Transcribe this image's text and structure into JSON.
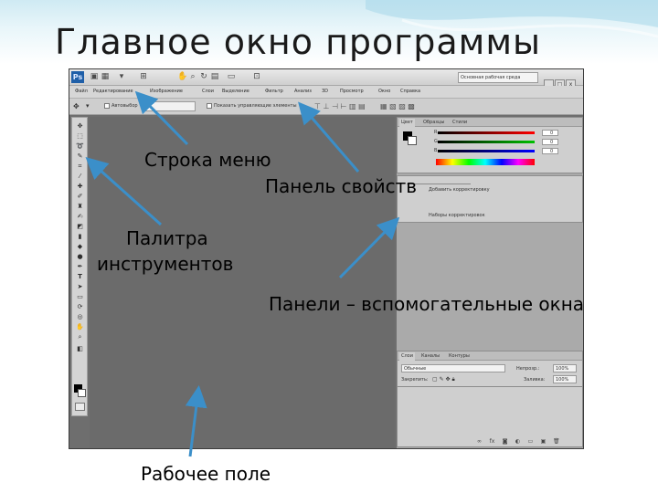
{
  "slide": {
    "title": "Главное окно программы"
  },
  "app": {
    "logo_text": "Ps",
    "workspace_select": "Основная рабочая среда",
    "window_buttons": [
      "_",
      "□",
      "x"
    ]
  },
  "menubar": {
    "items": [
      "Файл",
      "Редактирование",
      "Изображение",
      "Слои",
      "Выделение",
      "Фильтр",
      "Анализ",
      "3D",
      "Просмотр",
      "Окно",
      "Справка"
    ]
  },
  "options_bar": {
    "checkbox_label": "Автовыбор",
    "checkbox2_label": "Показать управляющие элементы"
  },
  "panels": {
    "color": {
      "tabs": [
        "Цвет",
        "Образцы",
        "Стили"
      ],
      "channels": [
        "R",
        "G",
        "B"
      ],
      "values": [
        "0",
        "0",
        "0"
      ]
    },
    "adjustments": {
      "items": [
        "Добавить корректировку",
        "Наборы корректировок"
      ]
    },
    "layers": {
      "tabs": [
        "Слои",
        "Каналы",
        "Контуры"
      ],
      "mode": "Обычные",
      "opacity_label": "Непрозр.:",
      "opacity_value": "100%",
      "lock_label": "Закрепить:",
      "fill_label": "Заливка:",
      "fill_value": "100%"
    }
  },
  "annotations": {
    "menu_bar": "Строка меню",
    "properties_panel": "Панель свойств",
    "tools_palette_line1": "Палитра",
    "tools_palette_line2": "инструментов",
    "panels_label": "Панели – вспомогательные окна",
    "workspace": "Рабочее поле"
  },
  "colors": {
    "window_bg": "#6e6e6e",
    "accent_arrow": "#3b8fc9",
    "ps_logo": "#1f5fa8"
  }
}
